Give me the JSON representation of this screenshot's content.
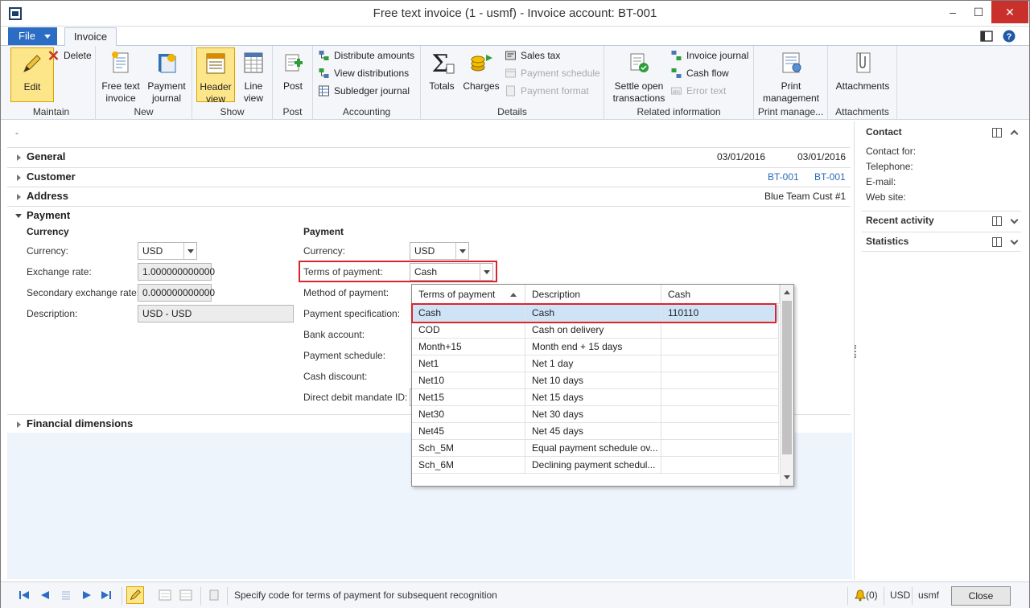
{
  "window": {
    "title": "Free text invoice (1 - usmf) - Invoice account: BT-001",
    "minimize": "–",
    "maximize": "☐",
    "close": "✕"
  },
  "tabs": {
    "file": "File",
    "invoice": "Invoice"
  },
  "ribbon": {
    "maintain": {
      "label": "Maintain",
      "edit": "Edit",
      "delete": "Delete"
    },
    "new": {
      "label": "New",
      "free_text_invoice": "Free text invoice",
      "payment_journal": "Payment journal"
    },
    "show": {
      "label": "Show",
      "header_view": "Header view",
      "line_view": "Line view"
    },
    "post": {
      "label": "Post",
      "post": "Post"
    },
    "accounting": {
      "label": "Accounting",
      "distribute": "Distribute amounts",
      "view_dist": "View distributions",
      "subledger": "Subledger journal"
    },
    "details": {
      "label": "Details",
      "totals": "Totals",
      "charges": "Charges",
      "sales_tax": "Sales tax",
      "payment_schedule": "Payment schedule",
      "payment_format": "Payment format"
    },
    "related": {
      "label": "Related information",
      "settle": "Settle open transactions",
      "invoice_journal": "Invoice journal",
      "cash_flow": "Cash flow",
      "error_text": "Error text"
    },
    "print": {
      "label": "Print manage...",
      "print_mgmt": "Print management"
    },
    "attachments": {
      "label": "Attachments",
      "attachments": "Attachments"
    }
  },
  "form": {
    "dash": "-",
    "general": {
      "title": "General",
      "date1": "03/01/2016",
      "date2": "03/01/2016"
    },
    "customer": {
      "title": "Customer",
      "acct1": "BT-001",
      "acct2": "BT-001"
    },
    "address": {
      "title": "Address",
      "name": "Blue Team Cust #1"
    },
    "payment": {
      "title": "Payment",
      "currency_group": "Currency",
      "currency_label": "Currency:",
      "currency_value": "USD",
      "exchange_label": "Exchange rate:",
      "exchange_value": "1.000000000000",
      "secondary_label": "Secondary exchange rate:",
      "secondary_value": "0.000000000000",
      "description_label": "Description:",
      "description_value": "USD - USD",
      "payment_group": "Payment",
      "pay_currency_label": "Currency:",
      "pay_currency_value": "USD",
      "terms_label": "Terms of payment:",
      "terms_value": "Cash",
      "method_label": "Method of payment:",
      "spec_label": "Payment specification:",
      "bank_label": "Bank account:",
      "schedule_label": "Payment schedule:",
      "cash_discount_label": "Cash discount:",
      "mandate_label": "Direct debit mandate ID:"
    },
    "financial": {
      "title": "Financial dimensions"
    }
  },
  "dropdown": {
    "headers": [
      "Terms of payment",
      "Description",
      "Cash"
    ],
    "rows": [
      {
        "code": "Cash",
        "desc": "Cash",
        "cash": "110110"
      },
      {
        "code": "COD",
        "desc": "Cash on delivery",
        "cash": ""
      },
      {
        "code": "Month+15",
        "desc": "Month end + 15 days",
        "cash": ""
      },
      {
        "code": "Net1",
        "desc": "Net 1 day",
        "cash": ""
      },
      {
        "code": "Net10",
        "desc": "Net 10 days",
        "cash": ""
      },
      {
        "code": "Net15",
        "desc": "Net 15 days",
        "cash": ""
      },
      {
        "code": "Net30",
        "desc": "Net 30 days",
        "cash": ""
      },
      {
        "code": "Net45",
        "desc": "Net 45 days",
        "cash": ""
      },
      {
        "code": "Sch_5M",
        "desc": "Equal payment schedule ov...",
        "cash": ""
      },
      {
        "code": "Sch_6M",
        "desc": "Declining payment schedul...",
        "cash": ""
      }
    ]
  },
  "factbox": {
    "contact": {
      "title": "Contact",
      "contact_for": "Contact for:",
      "telephone": "Telephone:",
      "email": "E-mail:",
      "website": "Web site:"
    },
    "recent": "Recent activity",
    "statistics": "Statistics"
  },
  "status": {
    "help_text": "Specify code for terms of payment for subsequent recognition",
    "alerts": "(0)",
    "currency": "USD",
    "company": "usmf",
    "close": "Close"
  },
  "colors": {
    "accent": "#2b6cc4",
    "highlight": "#d9262c",
    "selected_row": "#cfe3f7"
  }
}
